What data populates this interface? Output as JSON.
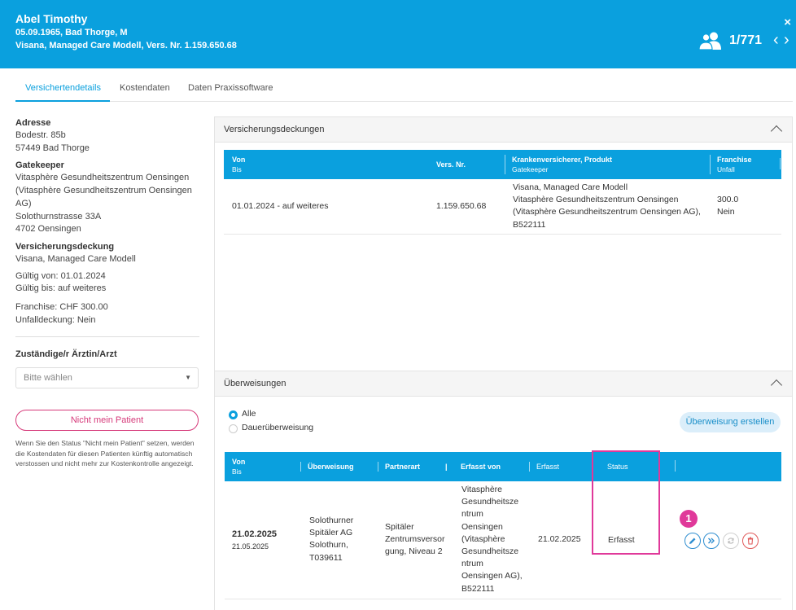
{
  "header": {
    "name": "Abel Timothy",
    "line1": "05.09.1965, Bad Thorge, M",
    "line2": "Visana, Managed Care Modell, Vers. Nr. 1.159.650.68",
    "counter": "1/771",
    "close": "×",
    "prev": "‹",
    "next": "›",
    "icons": {
      "users": "users-icon",
      "close": "close-icon"
    }
  },
  "tabs": [
    {
      "label": "Versichertendetails",
      "active": true
    },
    {
      "label": "Kostendaten",
      "active": false
    },
    {
      "label": "Daten Praxissoftware",
      "active": false
    }
  ],
  "sidebar": {
    "address": {
      "label": "Adresse",
      "lines": [
        "Bodestr. 85b",
        "57449 Bad Thorge"
      ]
    },
    "gatekeeper": {
      "label": "Gatekeeper",
      "lines": [
        "Vitasphère Gesundheitszentrum Oensingen",
        "(Vitasphère Gesundheitszentrum Oensingen",
        "AG)",
        "Solothurnstrasse 33A",
        "4702 Oensingen"
      ]
    },
    "coverage": {
      "label": "Versicherungsdeckung",
      "product": "Visana, Managed Care Modell",
      "valid_from": "Gültig von: 01.01.2024",
      "valid_to": "Gültig bis: auf weiteres",
      "franchise": "Franchise: CHF 300.00",
      "accident": "Unfalldeckung: Nein"
    },
    "doctor": {
      "label": "Zuständige/r Ärztin/Arzt",
      "placeholder": "Bitte wählen"
    },
    "not_mine_button": "Nicht mein Patient",
    "note": "Wenn Sie den Status \"Nicht mein Patient\" setzen, werden die Kostendaten für diesen Patienten künftig automatisch verstossen und nicht mehr zur Kostenkontrolle angezeigt."
  },
  "coverage_panel": {
    "title": "Versicherungsdeckungen",
    "columns": {
      "von": "Von",
      "bis": "Bis",
      "vers_nr": "Vers. Nr.",
      "insurer": "Krankenversicherer, Produkt",
      "gatekeeper": "Gatekeeper",
      "franchise": "Franchise",
      "unfall": "Unfall"
    },
    "row": {
      "period": "01.01.2024 - auf weiteres",
      "vers_nr": "1.159.650.68",
      "insurer_lines": [
        "Visana, Managed Care Modell",
        "Vitasphère Gesundheitszentrum Oensingen",
        "(Vitasphère Gesundheitszentrum Oensingen AG),",
        "B522111"
      ],
      "franchise": "300.0",
      "unfall": "Nein"
    }
  },
  "referrals_panel": {
    "title": "Überweisungen",
    "filters": [
      {
        "label": "Alle",
        "selected": true
      },
      {
        "label": "Dauerüberweisung",
        "selected": false
      }
    ],
    "create_button": "Überweisung erstellen",
    "columns": {
      "von": "Von",
      "bis": "Bis",
      "referral": "Überweisung",
      "partner_type": "Partnerart",
      "recorded_by": "Erfasst von",
      "recorded": "Erfasst",
      "status": "Status"
    },
    "row": {
      "from": "21.02.2025",
      "to": "21.05.2025",
      "referral_lines": [
        "Solothurner",
        "Spitäler AG",
        "Solothurn,",
        "T039611"
      ],
      "partner_lines": [
        "Spitäler",
        "Zentrumsversor",
        "gung, Niveau 2"
      ],
      "recorded_by_lines": [
        "Vitasphère",
        "Gesundheitsze",
        "ntrum",
        "Oensingen",
        "(Vitasphère",
        "Gesundheitsze",
        "ntrum",
        "Oensingen AG),",
        "B522111"
      ],
      "recorded": "21.02.2025",
      "status": "Erfasst"
    },
    "annotation_badge": "1",
    "actions": [
      "edit-icon",
      "forward-icon",
      "refresh-icon",
      "delete-icon"
    ]
  }
}
